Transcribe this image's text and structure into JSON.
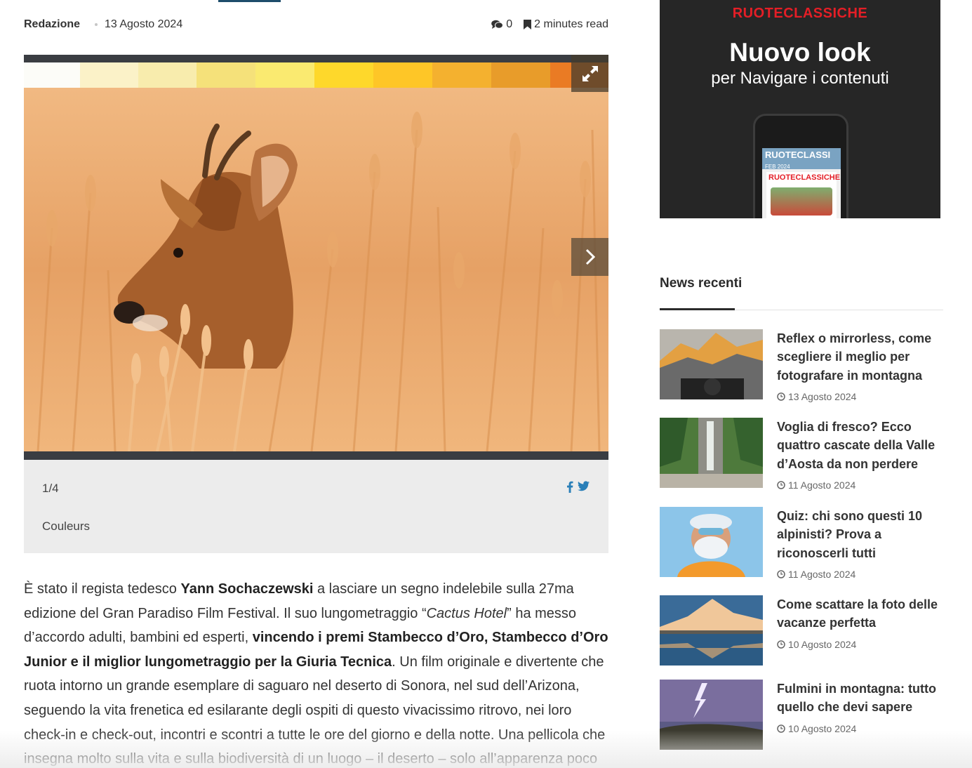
{
  "meta": {
    "author": "Redazione",
    "date": "13 Agosto 2024",
    "comments": "0",
    "read_time": "2 minutes read"
  },
  "gallery": {
    "counter": "1/4",
    "caption": "Couleurs",
    "palette": [
      "#fcfcf8",
      "#fbf2c8",
      "#f8ecad",
      "#f5e17a",
      "#faea70",
      "#fed82b",
      "#fec627",
      "#f4b12f",
      "#e89c2a",
      "#ea7b24"
    ]
  },
  "article": {
    "p1_a": "È stato il regista tedesco ",
    "p1_b": "Yann Sochaczewski",
    "p1_c": " a lasciare un segno indelebile sulla 27ma edizione del Gran Paradiso Film Festival. Il suo lungometraggio “",
    "p1_d": "Cactus Hotel",
    "p1_e": "” ha messo d’accordo adulti, bambini ed esperti, ",
    "p1_f": "vincendo i premi Stambecco d’Oro, Stambecco d’Oro Junior e il miglior lungometraggio per la Giuria Tecnica",
    "p1_g": ". Un film originale e divertente che ruota intorno un grande esemplare di saguaro nel deserto di Sonora, nel sud dell’Arizona, seguendo la vita frenetica ed esilarante degli ospiti di questo vivacissimo ritrovo, nei loro check-in e check-out, incontri e scontri a tutte le ore del giorno e della notte. Una pellicola che insegna molto sulla vita e sulla biodiversità di un luogo – il deserto – solo all’apparenza poco"
  },
  "ad": {
    "brand": "RUOTECLASSICHE",
    "headline": "Nuovo look",
    "sub": "per Navigare i contenuti",
    "cover_strip": "RUOTECLASSI",
    "cover_date": "FEB 2024",
    "cover_title": "RUOTECLASSICHE"
  },
  "sidebar": {
    "heading": "News recenti",
    "items": [
      {
        "title": "Reflex o mirrorless, come scegliere il meglio per fotografare in montagna",
        "date": "13 Agosto 2024"
      },
      {
        "title": "Voglia di fresco? Ecco quattro cascate della Valle d’Aosta da non perdere",
        "date": "11 Agosto 2024"
      },
      {
        "title": "Quiz: chi sono questi 10 alpinisti? Prova a riconoscerli tutti",
        "date": "11 Agosto 2024"
      },
      {
        "title": "Come scattare la foto delle vacanze perfetta",
        "date": "10 Agosto 2024"
      },
      {
        "title": "Fulmini in montagna: tutto quello che devi sapere",
        "date": "10 Agosto 2024"
      }
    ]
  }
}
